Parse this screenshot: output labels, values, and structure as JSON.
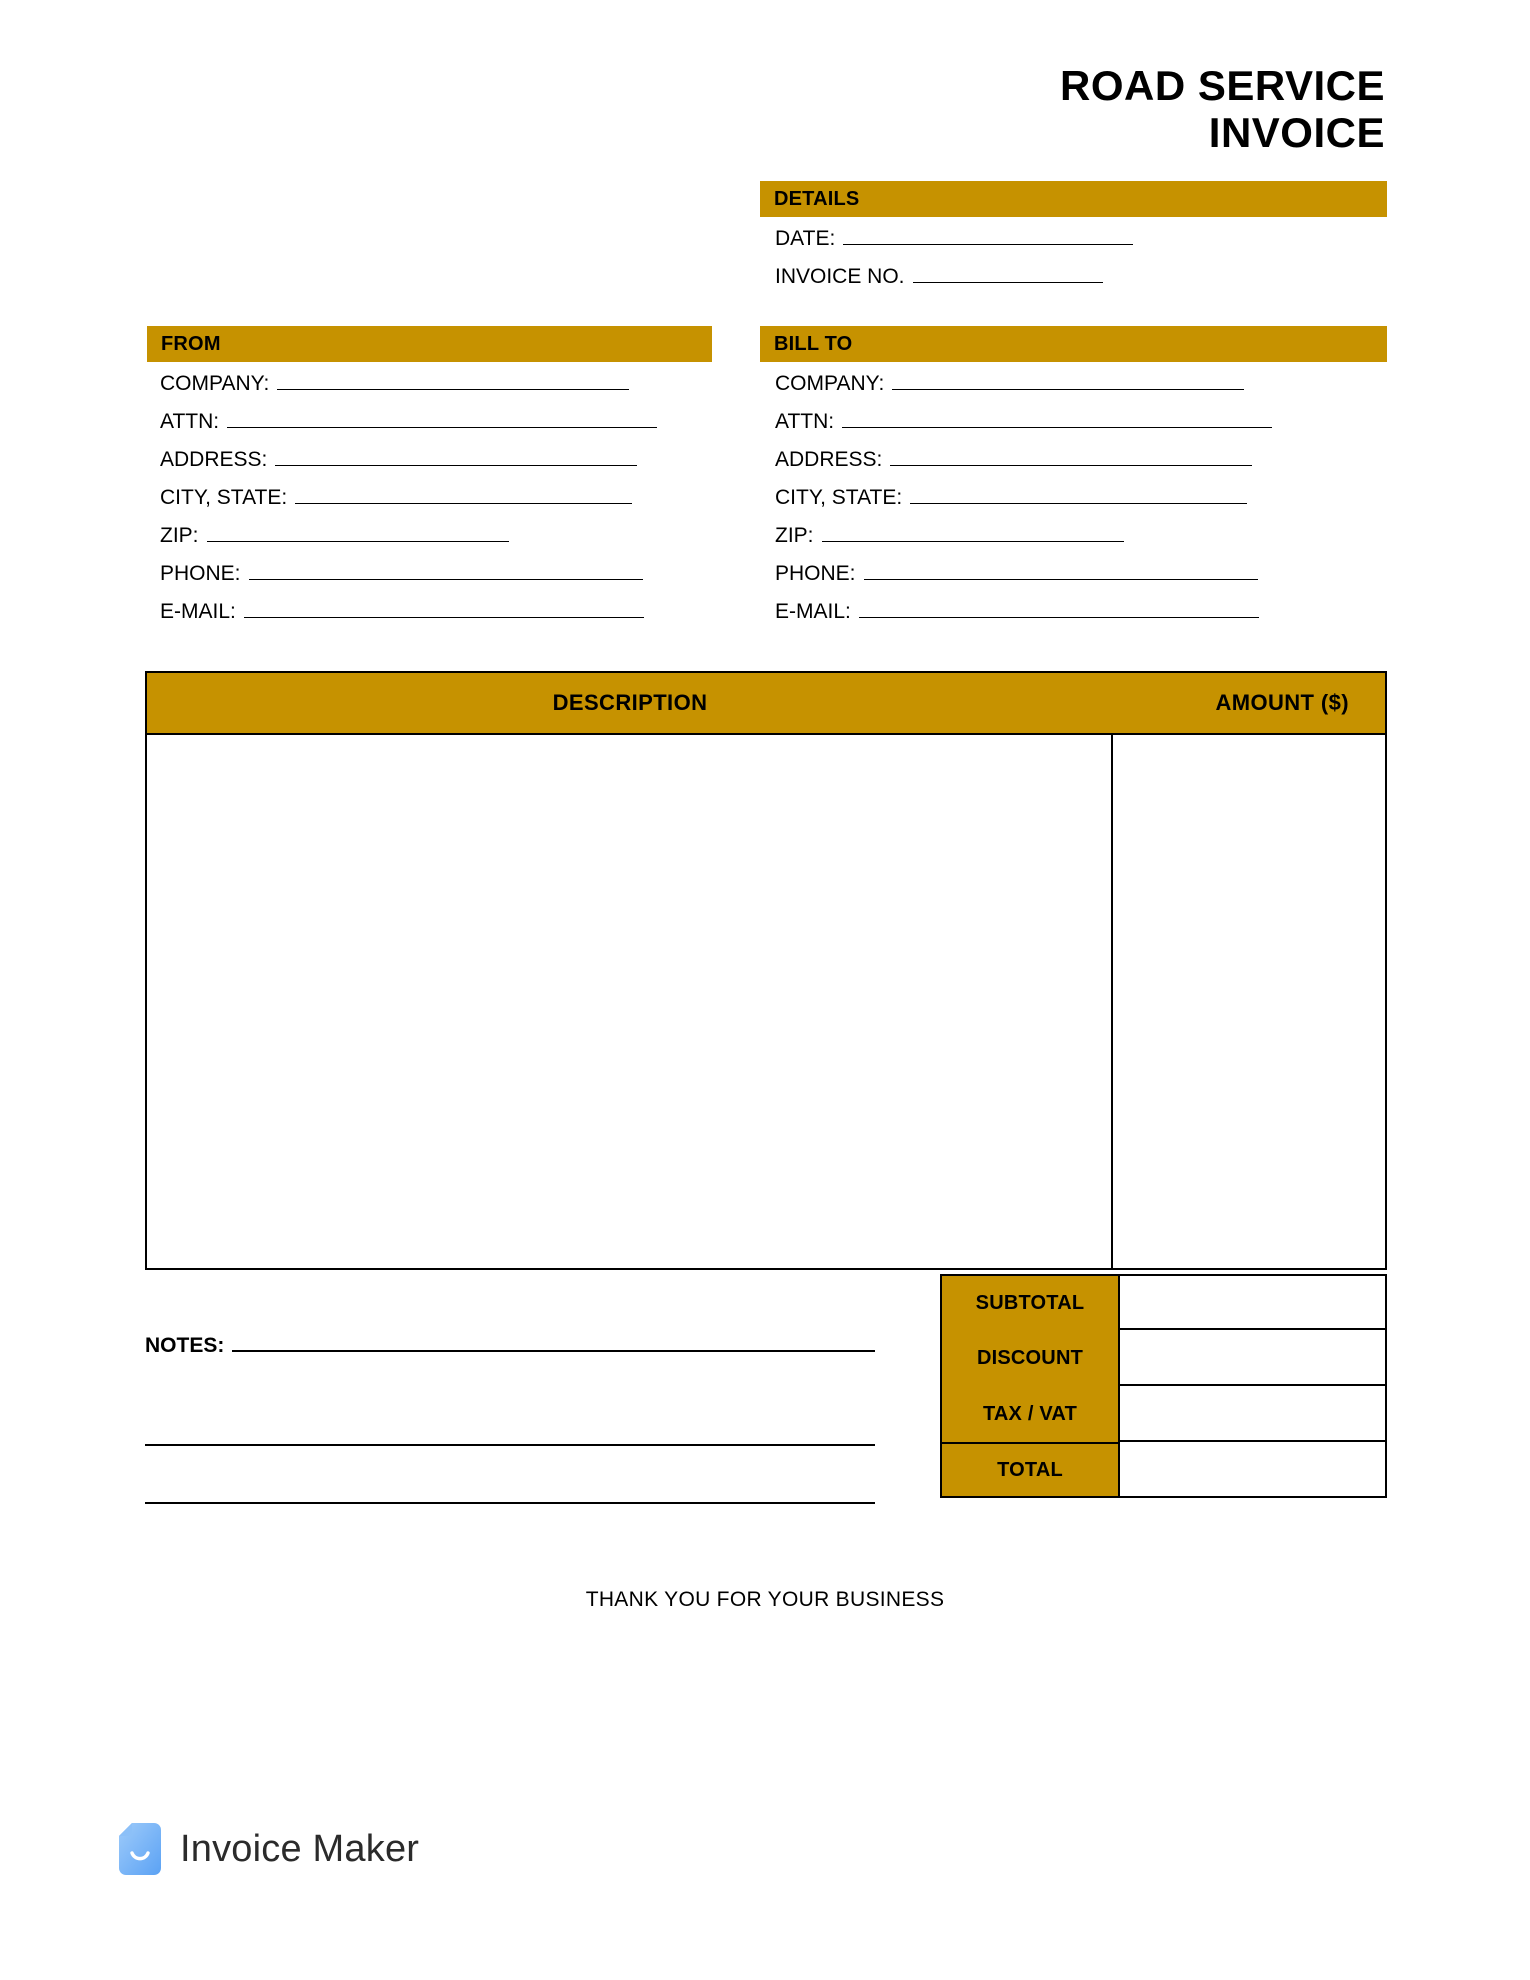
{
  "document": {
    "title_lines": [
      "ROAD SERVICE",
      "INVOICE"
    ],
    "accent_color": "#c69200",
    "background_color": "#ffffff"
  },
  "details": {
    "heading": "DETAILS",
    "fields": [
      {
        "label": "DATE:",
        "value": "",
        "rule_width": 290
      },
      {
        "label": "INVOICE NO.",
        "value": "",
        "rule_width": 190
      }
    ]
  },
  "from": {
    "heading": "FROM",
    "fields": [
      {
        "label": "COMPANY:",
        "value": "",
        "rule_width": 352
      },
      {
        "label": "ATTN:",
        "value": "",
        "rule_width": 430
      },
      {
        "label": "ADDRESS:",
        "value": "",
        "rule_width": 362
      },
      {
        "label": "CITY, STATE:",
        "value": "",
        "rule_width": 337
      },
      {
        "label": "ZIP:",
        "value": "",
        "rule_width": 302
      },
      {
        "label": "PHONE:",
        "value": "",
        "rule_width": 394
      },
      {
        "label": "E-MAIL:",
        "value": "",
        "rule_width": 400
      }
    ]
  },
  "bill_to": {
    "heading": "BILL TO",
    "fields": [
      {
        "label": "COMPANY:",
        "value": "",
        "rule_width": 352
      },
      {
        "label": "ATTN:",
        "value": "",
        "rule_width": 430
      },
      {
        "label": "ADDRESS:",
        "value": "",
        "rule_width": 362
      },
      {
        "label": "CITY, STATE:",
        "value": "",
        "rule_width": 337
      },
      {
        "label": "ZIP:",
        "value": "",
        "rule_width": 302
      },
      {
        "label": "PHONE:",
        "value": "",
        "rule_width": 394
      },
      {
        "label": "E-MAIL:",
        "value": "",
        "rule_width": 400
      }
    ]
  },
  "items_table": {
    "columns": [
      {
        "header": "DESCRIPTION",
        "align": "center"
      },
      {
        "header": "AMOUNT ($)",
        "align": "right"
      }
    ],
    "rows": []
  },
  "totals": [
    {
      "label": "SUBTOTAL",
      "value": ""
    },
    {
      "label": "DISCOUNT",
      "value": ""
    },
    {
      "label": "TAX / VAT",
      "value": ""
    },
    {
      "label": "TOTAL",
      "value": ""
    }
  ],
  "notes": {
    "label": "NOTES:",
    "value": "",
    "extra_lines": 2
  },
  "footer": {
    "thank_you": "THANK YOU FOR YOUR BUSINESS"
  },
  "brand": {
    "name": "Invoice Maker",
    "icon": "invoice-document-icon",
    "icon_color_start": "#8fc4f8",
    "icon_color_end": "#62a6f5"
  }
}
